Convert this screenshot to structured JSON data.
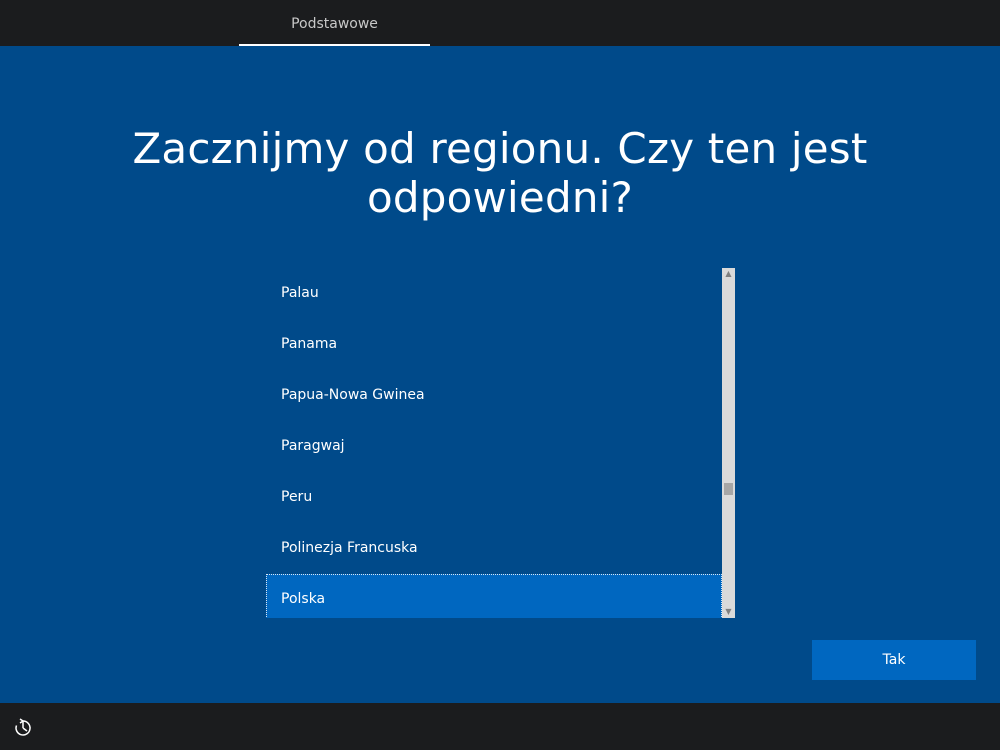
{
  "header": {
    "tab_label": "Podstawowe"
  },
  "main": {
    "title": "Zacznijmy od regionu. Czy ten jest odpowiedni?"
  },
  "region_list": {
    "items": [
      "Palau",
      "Panama",
      "Papua-Nowa Gwinea",
      "Paragwaj",
      "Peru",
      "Polinezja Francuska",
      "Polska"
    ],
    "selected": "Polska"
  },
  "actions": {
    "yes_label": "Tak"
  },
  "footer": {
    "accessibility_icon": "ease-of-access-icon"
  },
  "colors": {
    "background": "#004a8a",
    "bar": "#1b1c1e",
    "accent": "#0067c0"
  }
}
